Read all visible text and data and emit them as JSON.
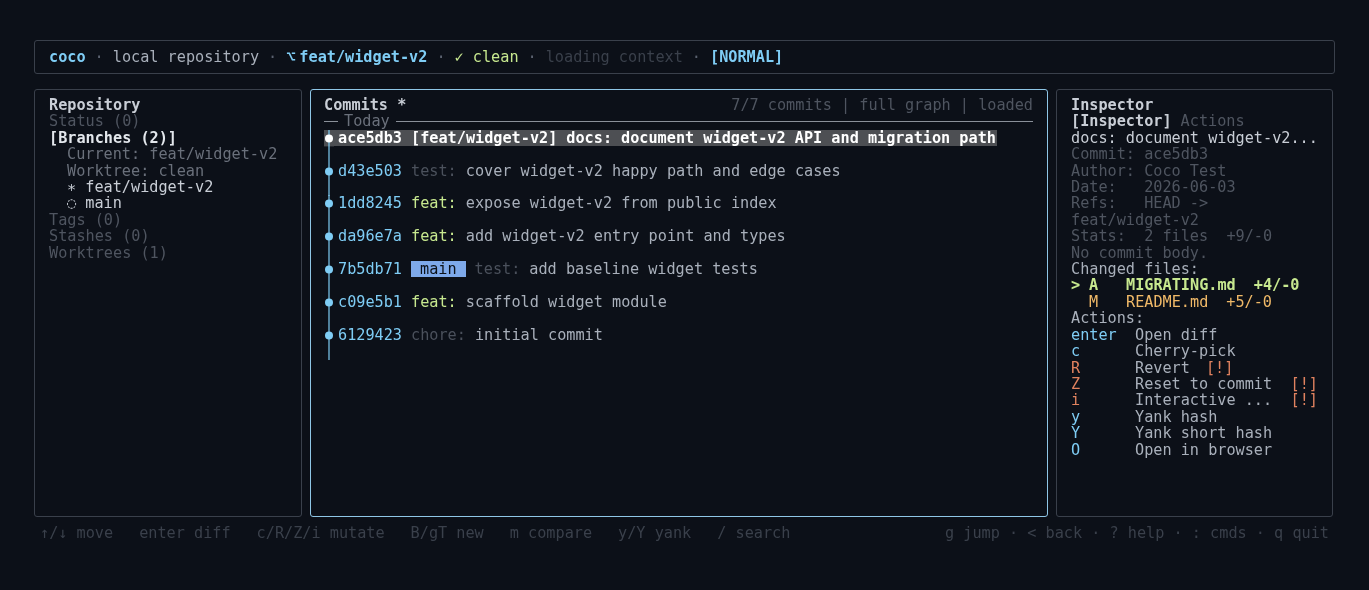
{
  "header": {
    "items": [
      {
        "kind": "app",
        "text": "coco"
      },
      {
        "kind": "sep",
        "text": "·"
      },
      {
        "kind": "plain",
        "text": "local repository"
      },
      {
        "kind": "sep",
        "text": "·"
      },
      {
        "kind": "branch",
        "icon": "⌥",
        "text": "feat/widget-v2"
      },
      {
        "kind": "sep",
        "text": "·"
      },
      {
        "kind": "status",
        "text": "✓ clean"
      },
      {
        "kind": "sep",
        "text": "·"
      },
      {
        "kind": "dim",
        "text": "loading context"
      },
      {
        "kind": "sep",
        "text": "·"
      },
      {
        "kind": "mode",
        "text": "[NORMAL]"
      }
    ]
  },
  "sidebar": {
    "title": "Repository",
    "items": [
      {
        "label": "Status (0)",
        "selected": false
      },
      {
        "label": "[Branches (2)]",
        "selected": true,
        "children": [
          {
            "kind": "info",
            "label": "Current: feat/widget-v2"
          },
          {
            "kind": "info",
            "label": "Worktree: clean"
          },
          {
            "kind": "branch",
            "label": "∗ feat/widget-v2"
          },
          {
            "kind": "branch",
            "label": "◌ main"
          }
        ]
      },
      {
        "label": "Tags (0)",
        "selected": false
      },
      {
        "label": "Stashes (0)",
        "selected": false
      },
      {
        "label": "Worktrees (1)",
        "selected": false
      }
    ]
  },
  "commits": {
    "title": "Commits *",
    "meta": "7/7 commits | full graph | loaded",
    "group": "Today",
    "rows": [
      {
        "hash": "ace5db3",
        "ref": {
          "kind": "bracket",
          "text": "[feat/widget-v2]"
        },
        "type": "docs:",
        "kind": "docs",
        "message": "document widget-v2 API and migration path",
        "selected": true
      },
      {
        "hash": "d43e503",
        "type": "test:",
        "kind": "test",
        "message": "cover widget-v2 happy path and edge cases",
        "selected": false
      },
      {
        "hash": "1dd8245",
        "type": "feat:",
        "kind": "feat",
        "message": "expose widget-v2 from public index",
        "selected": false
      },
      {
        "hash": "da96e7a",
        "type": "feat:",
        "kind": "feat",
        "message": "add widget-v2 entry point and types",
        "selected": false
      },
      {
        "hash": "7b5db71",
        "ref": {
          "kind": "badge",
          "text": "main"
        },
        "type": "test:",
        "kind": "test",
        "message": "add baseline widget tests",
        "selected": false
      },
      {
        "hash": "c09e5b1",
        "type": "feat:",
        "kind": "feat",
        "message": "scaffold widget module",
        "selected": false
      },
      {
        "hash": "6129423",
        "type": "chore:",
        "kind": "chore",
        "message": "initial commit",
        "selected": false
      }
    ]
  },
  "inspector": {
    "title": "Inspector",
    "tabs": [
      {
        "label": "[Inspector]",
        "selected": true
      },
      {
        "label": "Actions",
        "selected": false
      }
    ],
    "subject": "docs: document widget-v2...",
    "details": [
      "Commit: ace5db3",
      "Author: Coco Test",
      "Date:   2026-06-03",
      "Refs:   HEAD ->",
      "feat/widget-v2",
      "Stats:  2 files  +9/-0",
      "No commit body."
    ],
    "files_heading": "Changed files:",
    "files": [
      {
        "marker": ">",
        "status": "A",
        "kind": "added",
        "name": "MIGRATING.md",
        "stats": "+4/-0",
        "selected": true
      },
      {
        "status": "M",
        "kind": "modified",
        "name": "README.md",
        "stats": "+5/-0",
        "selected": false
      }
    ],
    "actions_heading": "Actions:",
    "actions": [
      {
        "key": "enter",
        "label": "Open diff",
        "danger": false
      },
      {
        "key": "c",
        "label": "Cherry-pick",
        "danger": false
      },
      {
        "key": "R",
        "label": "Revert",
        "danger": true,
        "flag": "[!]"
      },
      {
        "key": "Z",
        "label": "Reset to commit",
        "danger": true,
        "flag": "[!]"
      },
      {
        "key": "i",
        "label": "Interactive ...",
        "danger": true,
        "flag": "[!]"
      },
      {
        "key": "y",
        "label": "Yank hash",
        "danger": false
      },
      {
        "key": "Y",
        "label": "Yank short hash",
        "danger": false
      },
      {
        "key": "O",
        "label": "Open in browser",
        "danger": false
      }
    ]
  },
  "footer": {
    "hints": [
      "↑/↓ move",
      "enter diff",
      "c/R/Z/i mutate",
      "B/gT new",
      "m compare",
      "y/Y yank",
      "/ search"
    ],
    "right": "g jump · < back · ? help · : cmds · q quit"
  }
}
